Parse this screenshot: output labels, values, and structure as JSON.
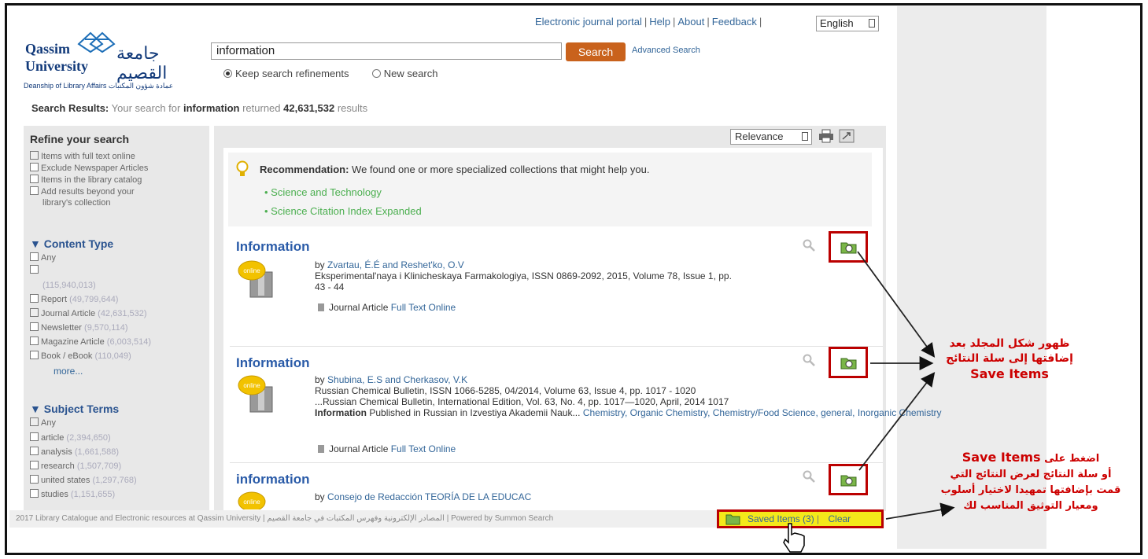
{
  "top_nav": {
    "links": [
      "Electronic journal portal",
      "Help",
      "About",
      "Feedback"
    ],
    "language": "English"
  },
  "logo": {
    "line1": "Qassim",
    "line2": "University",
    "arabic": "جامعة القصيم",
    "subtitle": "Deanship of Library Affairs عمادة شؤون المكتبات"
  },
  "search": {
    "query": "information",
    "button": "Search",
    "advanced": "Advanced Search",
    "opt_keep": "Keep search refinements",
    "opt_new": "New search"
  },
  "summary": {
    "label": "Search Results:",
    "pre": "Your search for",
    "term": "information",
    "mid": "returned",
    "count": "42,631,532",
    "post": "results"
  },
  "sidebar": {
    "title": "Refine your search",
    "options": [
      "Items with full text online",
      "Exclude Newspaper Articles",
      "Items in the library catalog",
      "Add results beyond your",
      "library's collection"
    ],
    "content_type": {
      "title": "Content Type",
      "items": [
        {
          "label": "Any",
          "count": ""
        },
        {
          "label": "",
          "count": "(115,940,013)"
        },
        {
          "label": "Report",
          "count": "(49,799,644)"
        },
        {
          "label": "Journal Article",
          "count": "(42,631,532)"
        },
        {
          "label": "Newsletter",
          "count": "(9,570,114)"
        },
        {
          "label": "Magazine Article",
          "count": "(6,003,514)"
        },
        {
          "label": "Book / eBook",
          "count": "(110,049)"
        }
      ],
      "more": "more..."
    },
    "subject_terms": {
      "title": "Subject Terms",
      "items": [
        {
          "label": "Any",
          "count": ""
        },
        {
          "label": "article",
          "count": "(2,394,650)"
        },
        {
          "label": "analysis",
          "count": "(1,661,588)"
        },
        {
          "label": "research",
          "count": "(1,507,709)"
        },
        {
          "label": "united states",
          "count": "(1,297,768)"
        },
        {
          "label": "studies",
          "count": "(1,151,655)"
        }
      ]
    }
  },
  "sort": {
    "value": "Relevance"
  },
  "recommendation": {
    "label": "Recommendation:",
    "text": "We found one or more specialized collections that might help you.",
    "links": [
      "Science and Technology",
      "Science Citation Index Expanded"
    ]
  },
  "results": [
    {
      "title": "Information",
      "by": "by",
      "authors": "Zvartau, É.É and Reshet'ko, O.V",
      "source": "Eksperimental'naya i Klinicheskaya Farmakologiya, ISSN 0869-2092, 2015, Volume 78, Issue 1, pp.",
      "source2": "43 - 44",
      "snippet": "",
      "snippet2": "",
      "subjects": "",
      "type": "Journal Article",
      "fulltext": "Full Text Online"
    },
    {
      "title": "Information",
      "by": "by",
      "authors": "Shubina, E.S and Cherkasov, V.K",
      "source": "Russian Chemical Bulletin, ISSN 1066-5285, 04/2014, Volume 63, Issue 4, pp. 1017 - 1020",
      "source2": "",
      "snippet": "...Russian Chemical Bulletin, International Edition, Vol. 63, No. 4, pp. 1017—1020, April, 2014 1017",
      "snippet2_bold": "Information",
      "snippet2": "Published in Russian in Izvestiya Akademii Nauk...",
      "subjects": "Chemistry, Organic Chemistry, Chemistry/Food Science, general, Inorganic Chemistry",
      "type": "Journal Article",
      "fulltext": "Full Text Online"
    },
    {
      "title": "information",
      "by": "by",
      "authors": "Consejo de Redacción TEORÍA DE LA EDUCAC",
      "type": "",
      "fulltext": ""
    }
  ],
  "badge_label": "online",
  "footer": {
    "text": "2017 Library Catalogue and Electronic resources at Qassim University | المصادر الإلكترونية وفهرس المكتبات في جامعة القصيم | Powered by Summon Search"
  },
  "saved": {
    "label": "Saved Items (3)",
    "clear": "Clear"
  },
  "annotations": {
    "a1_line1": "ظهور شكل المجلد بعد",
    "a1_line2": "إضافتها إلى سلة النتائج",
    "a1_en": "Save Items",
    "a2_line1_ar": "اضغط على",
    "a2_en": "Save Items",
    "a2_line2": "أو سلة النتائج لعرض النتائج التي",
    "a2_line3": "قمت بإضافتها تمهيدا لاختيار أسلوب",
    "a2_line4": "ومعيار التوثيق المناسب لك"
  },
  "colors": {
    "accent": "#c9621c",
    "link": "#336699",
    "annotation": "#cc0000",
    "highlight": "#f4e81a"
  }
}
